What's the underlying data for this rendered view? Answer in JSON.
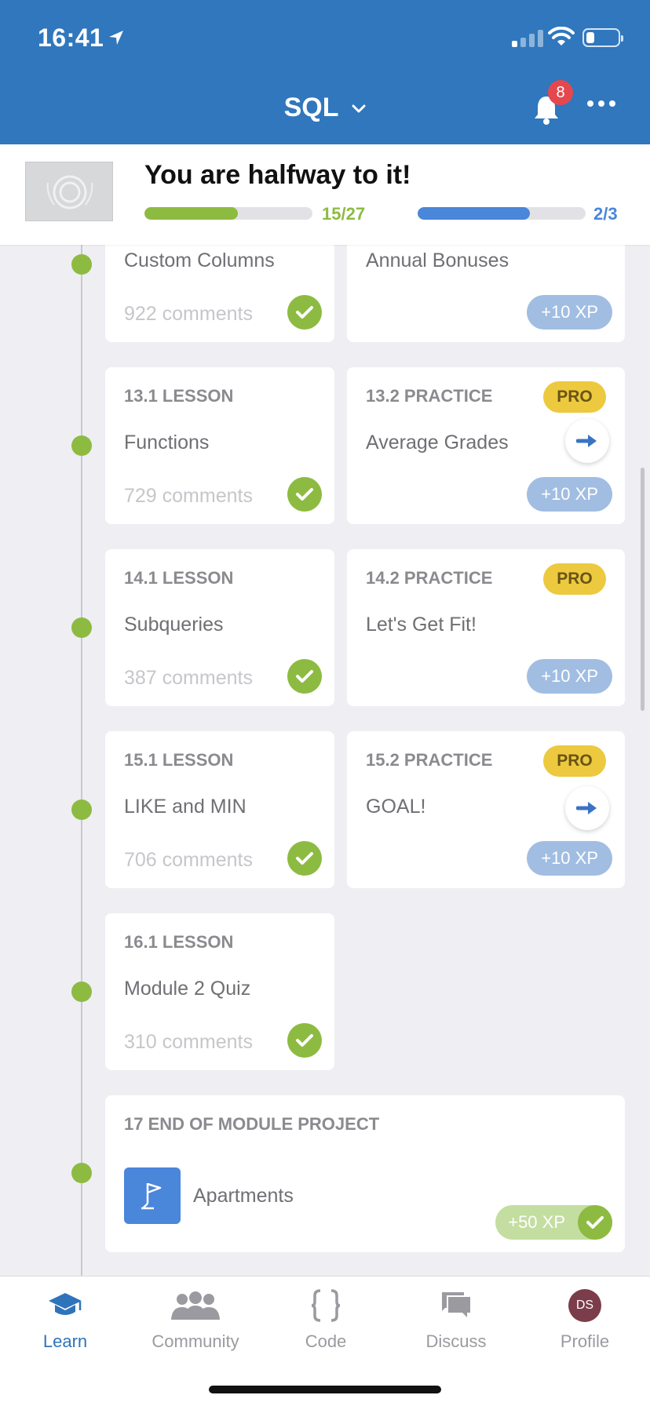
{
  "status_bar": {
    "time": "16:41",
    "battery_level": 0.25
  },
  "header": {
    "course_title": "SQL",
    "notification_count": "8"
  },
  "banner": {
    "title": "You are halfway to it!",
    "lessons_progress": {
      "label": "15/27",
      "fraction": 0.556,
      "color": "#8dbb42"
    },
    "certificate_progress": {
      "label": "2/3",
      "fraction": 0.667,
      "color": "#4a86d9"
    }
  },
  "rows": [
    {
      "lesson": {
        "title": "Custom Columns",
        "comments": "922 comments",
        "completed": true
      },
      "practice": {
        "title": "Annual Bonuses",
        "xp": "+10 XP"
      }
    },
    {
      "lesson": {
        "kind": "13.1 LESSON",
        "title": "Functions",
        "comments": "729 comments",
        "completed": true
      },
      "practice": {
        "kind": "13.2 PRACTICE",
        "title": "Average Grades",
        "badge": "PRO",
        "xp": "+10 XP",
        "has_go": true
      }
    },
    {
      "lesson": {
        "kind": "14.1 LESSON",
        "title": "Subqueries",
        "comments": "387 comments",
        "completed": true
      },
      "practice": {
        "kind": "14.2 PRACTICE",
        "title": "Let's Get Fit!",
        "badge": "PRO",
        "xp": "+10 XP",
        "has_go": false
      }
    },
    {
      "lesson": {
        "kind": "15.1 LESSON",
        "title": "LIKE and MIN",
        "comments": "706 comments",
        "completed": true
      },
      "practice": {
        "kind": "15.2 PRACTICE",
        "title": "GOAL!",
        "badge": "PRO",
        "xp": "+10 XP",
        "has_go": true
      }
    },
    {
      "lesson": {
        "kind": "16.1 LESSON",
        "title": "Module 2 Quiz",
        "comments": "310 comments",
        "completed": true
      }
    }
  ],
  "project": {
    "kind": "17 END OF MODULE PROJECT",
    "title": "Apartments",
    "xp": "+50 XP",
    "completed": true
  },
  "tabs": [
    {
      "label": "Learn",
      "icon": "graduation-cap-icon",
      "active": true
    },
    {
      "label": "Community",
      "icon": "people-icon",
      "active": false
    },
    {
      "label": "Code",
      "icon": "code-braces-icon",
      "active": false
    },
    {
      "label": "Discuss",
      "icon": "chat-bubbles-icon",
      "active": false
    },
    {
      "label": "Profile",
      "icon": "avatar-icon",
      "active": false,
      "avatar_initials": "DS"
    }
  ],
  "colors": {
    "header_blue": "#3077bd",
    "accent_green": "#8dbb42",
    "pro_yellow": "#ecc93e",
    "xp_blue": "#a1bde2"
  }
}
